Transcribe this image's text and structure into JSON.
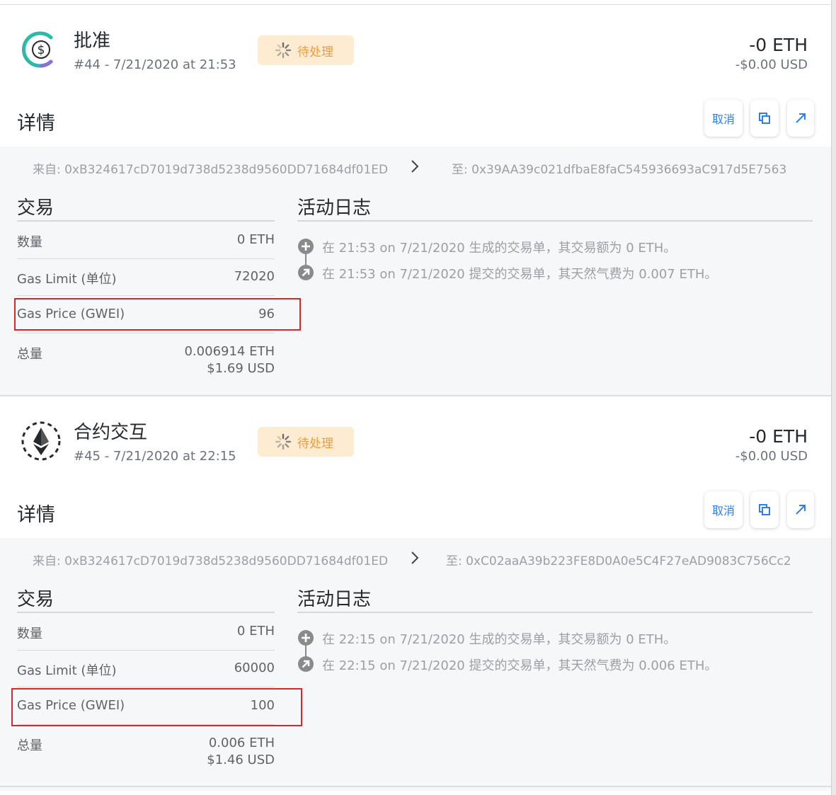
{
  "transactions": [
    {
      "title": "批准",
      "subtitle": "#44 - 7/21/2020 at 21:53",
      "icon": "usdc-approve-icon",
      "status": "待处理",
      "amount_eth": "-0 ETH",
      "amount_usd": "-$0.00 USD",
      "details_label": "详情",
      "cancel_label": "取消",
      "from": "来自: 0xB324617cD7019d738d5238d9560DD71684df01ED",
      "to": "至: 0x39AA39c021dfbaE8faC545936693aC917d5E7563",
      "tx_heading": "交易",
      "log_heading": "活动日志",
      "rows": {
        "quantity_label": "数量",
        "quantity_value": "0 ETH",
        "gas_limit_label": "Gas Limit (单位)",
        "gas_limit_value": "72020",
        "gas_price_label": "Gas Price (GWEI)",
        "gas_price_value": "96",
        "total_label": "总量",
        "total_eth": "0.006914 ETH",
        "total_usd": "$1.69 USD"
      },
      "log": [
        "在 21:53 on 7/21/2020 生成的交易单，其交易额为 0 ETH。",
        "在 21:53 on 7/21/2020 提交的交易单，其天然气费为 0.007 ETH。"
      ]
    },
    {
      "title": "合约交互",
      "subtitle": "#45 - 7/21/2020 at 22:15",
      "icon": "ethereum-icon",
      "status": "待处理",
      "amount_eth": "-0 ETH",
      "amount_usd": "-$0.00 USD",
      "details_label": "详情",
      "cancel_label": "取消",
      "from": "来自: 0xB324617cD7019d738d5238d9560DD71684df01ED",
      "to": "至: 0xC02aaA39b223FE8D0A0e5C4F27eAD9083C756Cc2",
      "tx_heading": "交易",
      "log_heading": "活动日志",
      "rows": {
        "quantity_label": "数量",
        "quantity_value": "0 ETH",
        "gas_limit_label": "Gas Limit (单位)",
        "gas_limit_value": "60000",
        "gas_price_label": "Gas Price (GWEI)",
        "gas_price_value": "100",
        "total_label": "总量",
        "total_eth": "0.006 ETH",
        "total_usd": "$1.46 USD"
      },
      "log": [
        "在 22:15 on 7/21/2020 生成的交易单，其交易额为 0 ETH。",
        "在 22:15 on 7/21/2020 提交的交易单，其天然气费为 0.006 ETH。"
      ]
    }
  ],
  "colors": {
    "pending_badge_bg": "#fdecd1",
    "pending_badge_text": "#f29a37",
    "action_blue": "#2f7fe8",
    "highlight_red": "#d9272e"
  }
}
